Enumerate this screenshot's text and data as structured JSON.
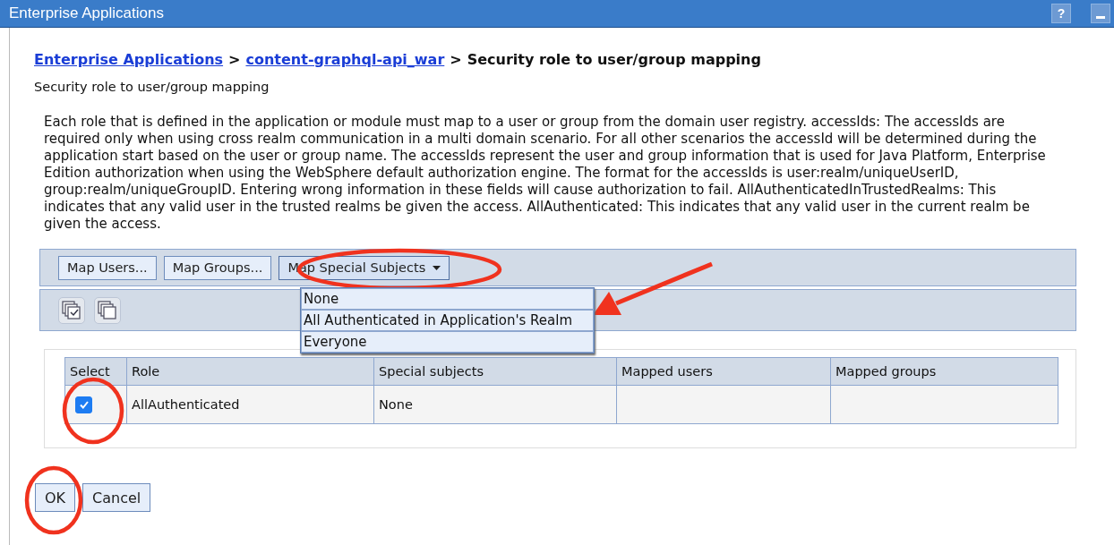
{
  "window": {
    "title": "Enterprise Applications",
    "help": "?"
  },
  "breadcrumb": [
    {
      "label": "Enterprise Applications",
      "kind": "link"
    },
    {
      "label": "content-graphql-api_war",
      "kind": "link"
    },
    {
      "label": "Security role to user/group mapping",
      "kind": "current"
    }
  ],
  "breadcrumb_separator": ">",
  "subtitle": "Security role to user/group mapping",
  "description": "Each role that is defined in the application or module must map to a user or group from the domain user registry. accessIds: The accessIds are required only when using cross realm communication in a multi domain scenario. For all other scenarios the accessId will be determined during the application start based on the user or group name. The accessIds represent the user and group information that is used for Java Platform, Enterprise Edition authorization when using the WebSphere default authorization engine. The format for the accessIds is user:realm/uniqueUserID, group:realm/uniqueGroupID. Entering wrong information in these fields will cause authorization to fail. AllAuthenticatedInTrustedRealms: This indicates that any valid user in the trusted realms be given the access. AllAuthenticated: This indicates that any valid user in the current realm be given the access.",
  "toolbar": [
    {
      "label": "Map Users...",
      "kind": "button"
    },
    {
      "label": "Map Groups...",
      "kind": "button"
    },
    {
      "label": "Map Special Subjects",
      "kind": "dropdown",
      "expanded": true
    }
  ],
  "dropdown_menu": [
    {
      "label": "None"
    },
    {
      "label": "All Authenticated in Application's Realm"
    },
    {
      "label": "Everyone"
    }
  ],
  "table": {
    "columns": [
      "Select",
      "Role",
      "Special subjects",
      "Mapped users",
      "Mapped groups"
    ],
    "rows": [
      {
        "selected": true,
        "role": "AllAuthenticated",
        "special_subjects": "None",
        "mapped_users": "",
        "mapped_groups": ""
      }
    ]
  },
  "buttons": [
    "OK",
    "Cancel"
  ]
}
